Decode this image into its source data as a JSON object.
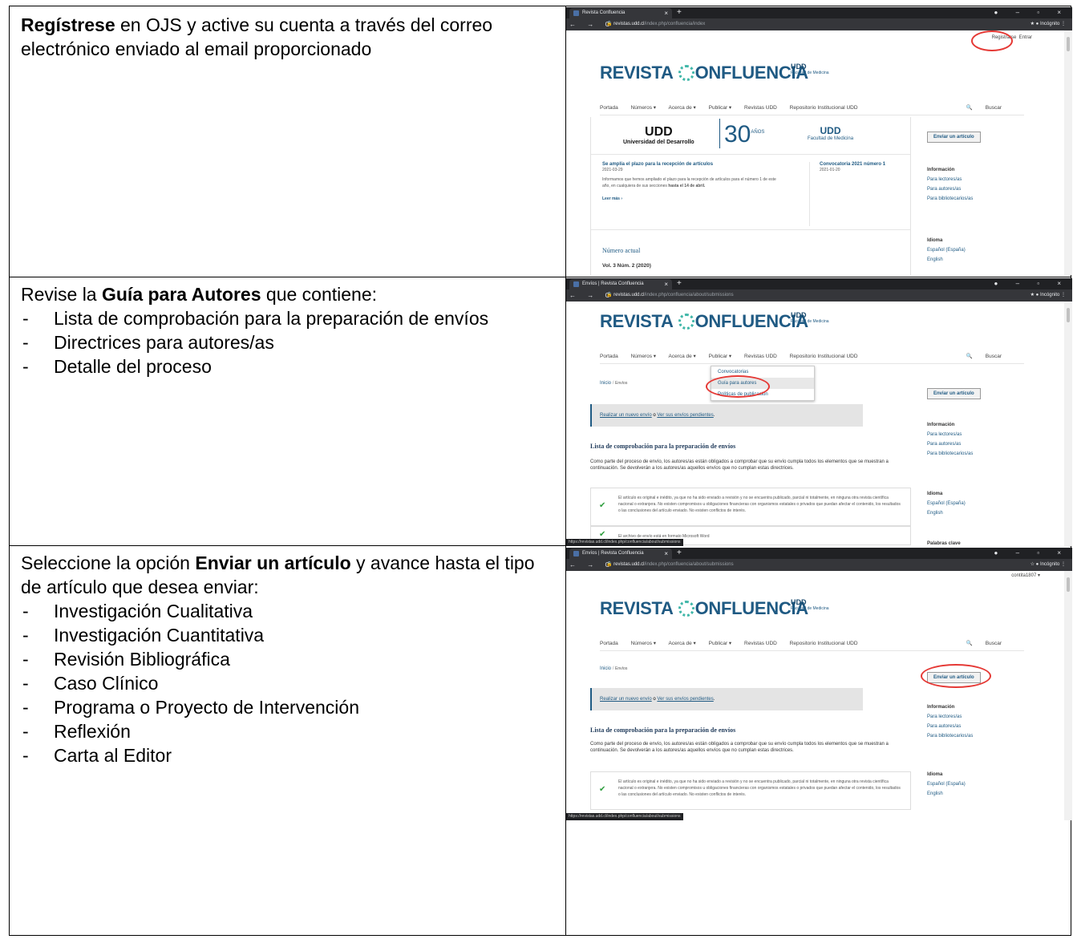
{
  "rows": [
    {
      "text_bold": "Regístrese",
      "text_rest": " en OJS y active su cuenta a través del correo electrónico enviado al email proporcionado"
    },
    {
      "text_pre": "Revise la ",
      "text_bold": "Guía para Autores",
      "text_post": " que contiene:",
      "items": [
        "Lista de comprobación para la preparación de envíos",
        "Directrices para autores/as",
        "Detalle del proceso"
      ]
    },
    {
      "text_pre": "Seleccione la opción ",
      "text_bold": "Enviar un artículo",
      "text_post": " y avance hasta el tipo de artículo que desea enviar:",
      "items": [
        "Investigación Cualitativa",
        "Investigación Cuantitativa",
        "Revisión Bibliográfica",
        "Caso Clínico",
        "Programa o Proyecto de Intervención",
        "Reflexión",
        "Carta al Editor"
      ]
    }
  ],
  "shots": {
    "shot1": {
      "tab": "Revista Confluencia",
      "url_host": "revistas.udd.cl",
      "url_path": "/index.php/confluencia/index",
      "incognito": "Incógnito",
      "register": "Registrarse",
      "login": "Entrar",
      "logo": "REVISTA CONFLUENCIA",
      "fac_udd": "UDD",
      "fac_label": "Facultad de Medicina",
      "menu": [
        "Portada",
        "Números ▾",
        "Acerca de ▾",
        "Publicar ▾",
        "Revistas UDD",
        "Repositorio Institucional UDD"
      ],
      "search": "Buscar",
      "banner_udd": "UDD",
      "banner_univ": "Universidad del Desarrollo",
      "banner_30": "30",
      "banner_anos": "AÑOS",
      "banner_fac": "Facultad de Medicina",
      "news1_title": "Se amplía el plazo para la recepción de artículos",
      "news1_date": "2021-03-29",
      "news1_body_a": "Informamos que hemos ampliado el plazo para la recepción de artículos para el número 1 de este",
      "news1_body_b": "año, en cualquiera de sus secciones ",
      "news1_body_bold": "hasta el 14 de abril.",
      "news1_more": "Leer más  ›",
      "news2_title": "Convocatoria 2021 número 1",
      "news2_date": "2021-01-20",
      "numero_actual": "Número actual",
      "volumen": "Vol. 3 Núm. 2 (2020)",
      "btn_enviar": "Enviar un artículo",
      "side_info": "Información",
      "side_links": [
        "Para lectores/as",
        "Para autores/as",
        "Para bibliotecarios/as"
      ],
      "side_lang": "Idioma",
      "side_langs": [
        "Español (España)",
        "English"
      ]
    },
    "shot2": {
      "tab": "Envíos | Revista Confluencia",
      "url_host": "revistas.udd.cl",
      "url_path": "/index.php/confluencia/about/submissions",
      "incognito": "Incógnito",
      "crumb_home": "Inicio",
      "crumb_sep": "/",
      "crumb_page": "Envíos",
      "dropdown": [
        "Convocatorias",
        "Guía para autores",
        "Políticas de publicación"
      ],
      "alert_link1": "Realizar un nuevo envío",
      "alert_mid": " o ",
      "alert_link2": "Ver sus envíos pendientes",
      "alert_end": ".",
      "checklist_title": "Lista de comprobación para la preparación de envíos",
      "checklist_intro": "Como parte del proceso de envío, los autores/as están obligados a comprobar que su envío cumpla todos los elementos que se muestran a continuación. Se devolverán a los autores/as aquellos envíos que no cumplan estas directrices.",
      "check1": "El artículo es original e inédito, ya que no ha sido enviado a revisión y no se encuentra publicado, parcial ni totalmente, en ninguna otra revista científica nacional o extranjera. No existen compromisos u obligaciones financieras con organismos estatales o privados que puedan afectar el contenido, los resultados o las conclusiones del artículo enviado. No existen conflictos de interés.",
      "check2": "El archivo de envío está en formato Microsoft Word",
      "side_kw": "Palabras clave",
      "status_url": "https://revistas.udd.cl/index.php/confluencia/about/submissions"
    },
    "shot3": {
      "user": "contita1807  ▾",
      "status_url": "https://revistas.udd.cl/index.php/confluencia/about/submissions"
    }
  }
}
